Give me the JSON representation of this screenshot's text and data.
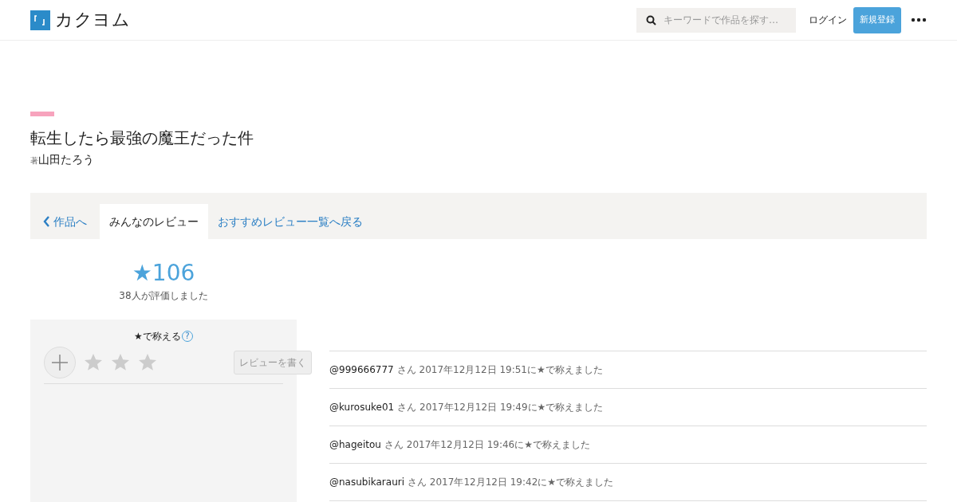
{
  "header": {
    "logo": "カクヨム",
    "search": {
      "placeholder": "キーワードで作品を探す…"
    },
    "login": "ログイン",
    "register": "新規登録"
  },
  "work": {
    "title": "転生したら最強の魔王だった件",
    "author_prefix": "著",
    "author": "山田たろう"
  },
  "breadcrumb": {
    "back": "作品へ",
    "items": [
      {
        "label": "みんなのレビュー",
        "selected": true
      },
      {
        "label": "おすすめレビュー一覧へ戻る",
        "selected": false
      }
    ]
  },
  "score": {
    "stars": "★106",
    "raters": "38人が評価しました"
  },
  "rate_panel": {
    "heading": "★で称える",
    "help": "?",
    "button": "レビューを書く"
  },
  "ratings": [
    {
      "user": "@999666777",
      "detail": "さん 2017年12月12日 19:51に★で称えました"
    },
    {
      "user": "@kurosuke01",
      "detail": "さん 2017年12月12日 19:49に★で称えました"
    },
    {
      "user": "@hageitou",
      "detail": "さん 2017年12月12日 19:46に★で称えました"
    },
    {
      "user": "@nasubikarauri",
      "detail": "さん 2017年12月12日 19:42に★で称えました"
    }
  ]
}
